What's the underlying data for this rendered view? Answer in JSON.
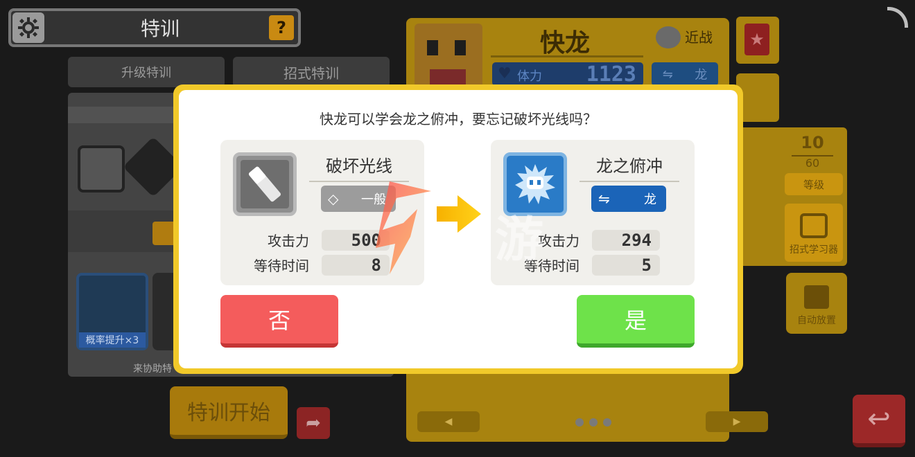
{
  "background": {
    "title": "特训",
    "help_label": "?",
    "tabs": {
      "upgrade": "升级特训",
      "move": "招式特训"
    },
    "probability_label": "概率提升×3",
    "assist_text": "来协助特",
    "start_label": "特训开始",
    "pokemon": {
      "name": "快龙",
      "style": "近战",
      "hp_label": "体力",
      "hp_value": "1123",
      "type": "龙"
    },
    "level": {
      "current": "10",
      "max": "60",
      "label": "等级"
    },
    "learner_label": "招式学习器",
    "auto_label": "自动放置",
    "nav": {
      "prev": "◀",
      "next": "▶"
    }
  },
  "dialog": {
    "question": "快龙可以学会龙之俯冲，要忘记破坏光线吗？",
    "old_move": {
      "name": "破坏光线",
      "type": "一般",
      "attack_label": "攻击力",
      "attack_value": "500",
      "wait_label": "等待时间",
      "wait_value": "8"
    },
    "new_move": {
      "name": "龙之俯冲",
      "type": "龙",
      "attack_label": "攻击力",
      "attack_value": "294",
      "wait_label": "等待时间",
      "wait_value": "5"
    },
    "no_label": "否",
    "yes_label": "是"
  },
  "watermark": {
    "text": "游"
  },
  "colors": {
    "dialog_border": "#f1c92a",
    "no_button": "#f45c5c",
    "yes_button": "#6ee24a",
    "dragon_type": "#1b64b8",
    "normal_type": "#9c9c9c"
  },
  "icons": [
    "gear-icon",
    "help-icon",
    "heart-icon",
    "dragon-type-icon",
    "normal-type-icon",
    "favorite-star-icon",
    "share-icon",
    "back-icon",
    "arrow-right-icon"
  ]
}
